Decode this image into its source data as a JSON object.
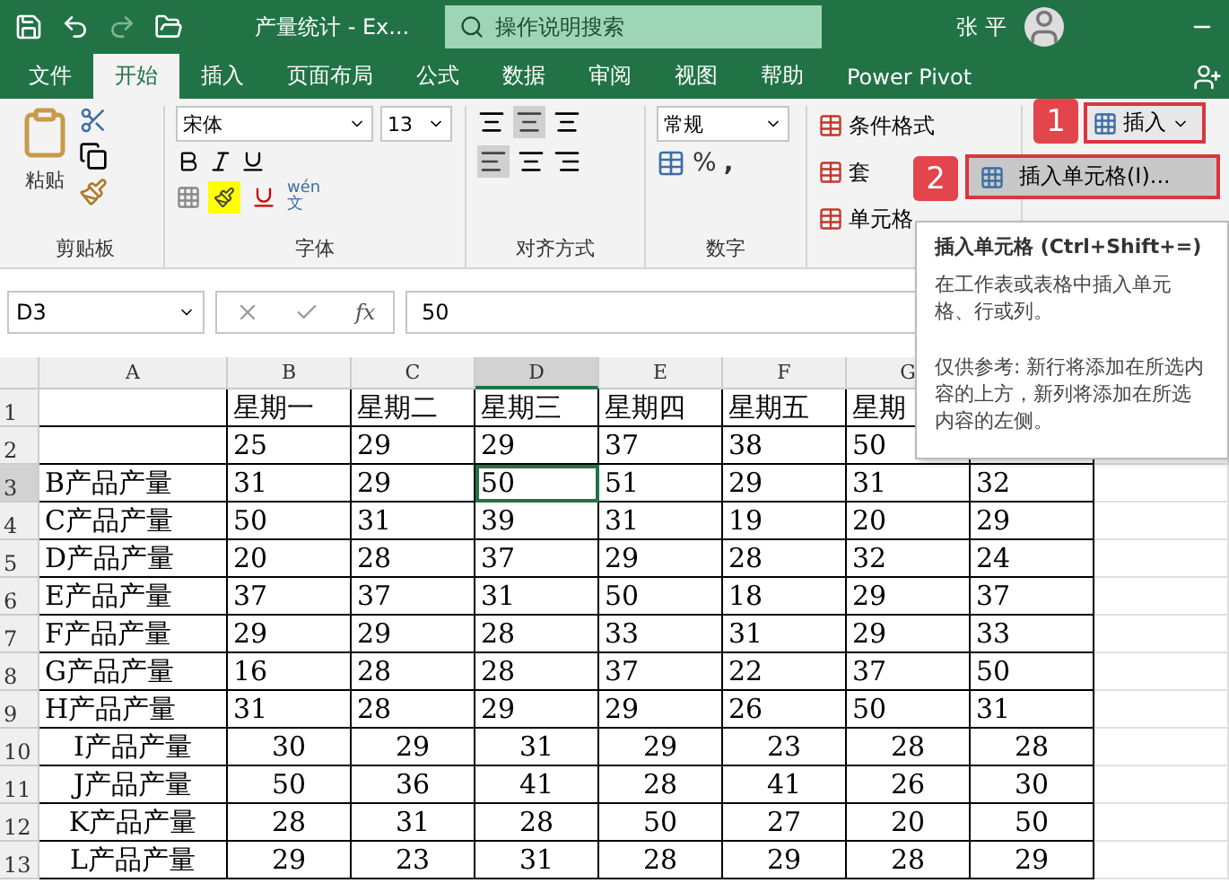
{
  "title_bar": {
    "document_title": "产量统计  -  Ex...",
    "search_placeholder": "操作说明搜索",
    "user": "张 平"
  },
  "ribbon_tabs": [
    {
      "label": "文件",
      "selected": false
    },
    {
      "label": "开始",
      "selected": true
    },
    {
      "label": "插入",
      "selected": false
    },
    {
      "label": "页面布局",
      "selected": false
    },
    {
      "label": "公式",
      "selected": false
    },
    {
      "label": "数据",
      "selected": false
    },
    {
      "label": "审阅",
      "selected": false
    },
    {
      "label": "视图",
      "selected": false
    },
    {
      "label": "帮助",
      "selected": false
    },
    {
      "label": "Power Pivot",
      "selected": false
    }
  ],
  "ribbon": {
    "clipboard": {
      "paste": "粘贴",
      "label": "剪贴板"
    },
    "font": {
      "name": "宋体",
      "size": "13",
      "phonetic": "wén",
      "phonetic_char": "文",
      "label": "字体"
    },
    "alignment": {
      "label": "对齐方式"
    },
    "number": {
      "format": "常规",
      "percent": "%",
      "comma": ",",
      "label": "数字"
    },
    "styles": [
      "条件格式",
      "套",
      "单元格"
    ],
    "cells": {
      "insert": "插入"
    }
  },
  "insert_menu": [
    {
      "label": "插入单元格(I)...",
      "selected": true
    }
  ],
  "step_badges": [
    "1",
    "2"
  ],
  "tooltip": {
    "title": "插入单元格 (Ctrl+Shift+=)",
    "description": "在工作表或表格中插入单元格、行或列。",
    "note": "仅供参考: 新行将添加在所选内容的上方，新列将添加在所选内容的左侧。"
  },
  "formula_bar": {
    "name_box": "D3",
    "fx": "fx",
    "value": "50"
  },
  "sheet": {
    "columns": [
      {
        "label": "A",
        "selected": false
      },
      {
        "label": "B",
        "selected": false
      },
      {
        "label": "C",
        "selected": false
      },
      {
        "label": "D",
        "selected": true
      },
      {
        "label": "E",
        "selected": false
      },
      {
        "label": "F",
        "selected": false
      },
      {
        "label": "G",
        "selected": false
      }
    ],
    "rows": [
      {
        "number": "1",
        "selected": false,
        "kind": "left",
        "cells": [
          "",
          "星期一",
          "星期二",
          "星期三",
          "星期四",
          "星期五",
          "星期"
        ]
      },
      {
        "number": "2",
        "selected": false,
        "kind": "left",
        "cells": [
          "",
          "25",
          "29",
          "29",
          "37",
          "38",
          "50"
        ]
      },
      {
        "number": "3",
        "selected": true,
        "kind": "left",
        "cells": [
          "B产品产量",
          "31",
          "29",
          "50",
          "51",
          "29",
          "31",
          "32"
        ]
      },
      {
        "number": "4",
        "selected": false,
        "kind": "left",
        "cells": [
          "C产品产量",
          "50",
          "31",
          "39",
          "31",
          "19",
          "20",
          "29"
        ]
      },
      {
        "number": "5",
        "selected": false,
        "kind": "left",
        "cells": [
          "D产品产量",
          "20",
          "28",
          "37",
          "29",
          "28",
          "32",
          "24"
        ]
      },
      {
        "number": "6",
        "selected": false,
        "kind": "left",
        "cells": [
          "E产品产量",
          "37",
          "37",
          "31",
          "50",
          "18",
          "29",
          "37"
        ]
      },
      {
        "number": "7",
        "selected": false,
        "kind": "left",
        "cells": [
          "F产品产量",
          "29",
          "29",
          "28",
          "33",
          "31",
          "29",
          "33"
        ]
      },
      {
        "number": "8",
        "selected": false,
        "kind": "left",
        "cells": [
          "G产品产量",
          "16",
          "28",
          "28",
          "37",
          "22",
          "37",
          "50"
        ]
      },
      {
        "number": "9",
        "selected": false,
        "kind": "left",
        "cells": [
          "H产品产量",
          "31",
          "28",
          "29",
          "29",
          "26",
          "50",
          "31"
        ]
      },
      {
        "number": "10",
        "selected": false,
        "kind": "center",
        "cells": [
          "I产品产量",
          "30",
          "29",
          "31",
          "29",
          "23",
          "28",
          "28"
        ]
      },
      {
        "number": "11",
        "selected": false,
        "kind": "center",
        "cells": [
          "J产品产量",
          "50",
          "36",
          "41",
          "28",
          "41",
          "26",
          "30"
        ]
      },
      {
        "number": "12",
        "selected": false,
        "kind": "center",
        "cells": [
          "K产品产量",
          "28",
          "31",
          "28",
          "50",
          "27",
          "20",
          "50"
        ]
      },
      {
        "number": "13",
        "selected": false,
        "kind": "center",
        "cells": [
          "L产品产量",
          "29",
          "23",
          "31",
          "28",
          "29",
          "28",
          "29"
        ]
      }
    ]
  }
}
